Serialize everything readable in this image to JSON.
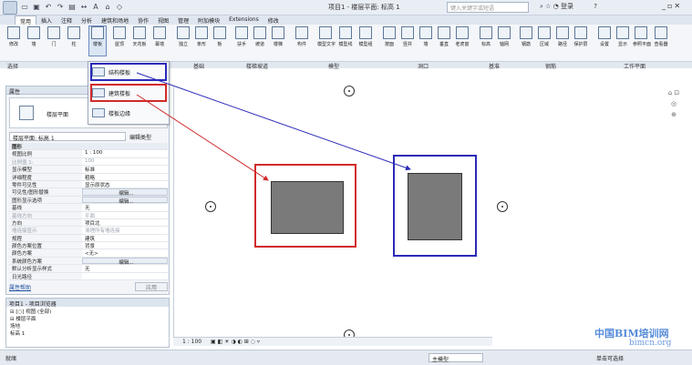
{
  "titlebar": {
    "title": "项目1 - 楼层平面: 标高 1",
    "search_placeholder": "键入关键字或短语",
    "login_label": "登录",
    "help_label": "?"
  },
  "tabs": [
    "常用",
    "插入",
    "注释",
    "分析",
    "建筑和场地",
    "协作",
    "视图",
    "管理",
    "附加模块",
    "Extensions",
    "修改"
  ],
  "ribbon": {
    "buttons": [
      "修改",
      "墙",
      "门",
      "柱",
      "楼板",
      "屋顶",
      "天花板",
      "幕墙",
      "独立",
      "条形",
      "板",
      "扶手",
      "坡道",
      "楼梯",
      "构件",
      "模型文字",
      "模型线",
      "模型组",
      "按面",
      "竖井",
      "墙",
      "垂直",
      "老虎窗",
      "标高",
      "轴网",
      "钢筋",
      "区域",
      "路径",
      "保护层",
      "设置",
      "显示",
      "参照平面",
      "查看器"
    ],
    "panels": [
      "选择",
      "基础",
      "楼梯坡道",
      "模型",
      "洞口",
      "基准",
      "钢筋",
      "工作平面"
    ]
  },
  "dropdown": {
    "items": [
      "结构楼板",
      "建筑楼板",
      "楼板边缘"
    ]
  },
  "properties": {
    "header": "属性",
    "type_name": "楼层平面",
    "view_selector": "楼层平面: 标高 1",
    "edit_type": "编辑类型",
    "rows": [
      {
        "k": "图形",
        "v": "",
        "group": true
      },
      {
        "k": "视图比例",
        "v": "1 : 100"
      },
      {
        "k": "比例值 1:",
        "v": "100",
        "dim": true
      },
      {
        "k": "显示模型",
        "v": "标准"
      },
      {
        "k": "详细程度",
        "v": "粗略"
      },
      {
        "k": "零件可见性",
        "v": "显示原状态"
      },
      {
        "k": "可见性/图形替换",
        "v": "编辑...",
        "btn": true
      },
      {
        "k": "图形显示选项",
        "v": "编辑...",
        "btn": true
      },
      {
        "k": "基线",
        "v": "无"
      },
      {
        "k": "基线方向",
        "v": "平面",
        "dim": true
      },
      {
        "k": "方向",
        "v": "项目北"
      },
      {
        "k": "墙连接显示",
        "v": "清理所有墙连接",
        "dim": true
      },
      {
        "k": "规程",
        "v": "建筑"
      },
      {
        "k": "颜色方案位置",
        "v": "背景"
      },
      {
        "k": "颜色方案",
        "v": "<无>"
      },
      {
        "k": "系统颜色方案",
        "v": "编辑...",
        "btn": true
      },
      {
        "k": "默认分析显示样式",
        "v": "无"
      },
      {
        "k": "日光路径",
        "v": ""
      }
    ],
    "help_link": "属性帮助",
    "apply": "应用"
  },
  "browser": {
    "header": "项目1 - 项目浏览器",
    "tree": [
      "⊟ [○] 视图 (全部)",
      "  ⊟ 楼层平面",
      "      场地",
      "      标高 1"
    ]
  },
  "viewbar": {
    "scale": "1 : 100"
  },
  "status": {
    "left": "就绪",
    "model": "主模型",
    "right": "单击可选择"
  },
  "watermark": {
    "line1": "中国BIM培训网",
    "line2": "bimcn.org"
  },
  "colors": {
    "red_highlight": "#d12a2a",
    "blue_highlight": "#2a2ab8",
    "floor_fill": "#7a7a7a"
  }
}
